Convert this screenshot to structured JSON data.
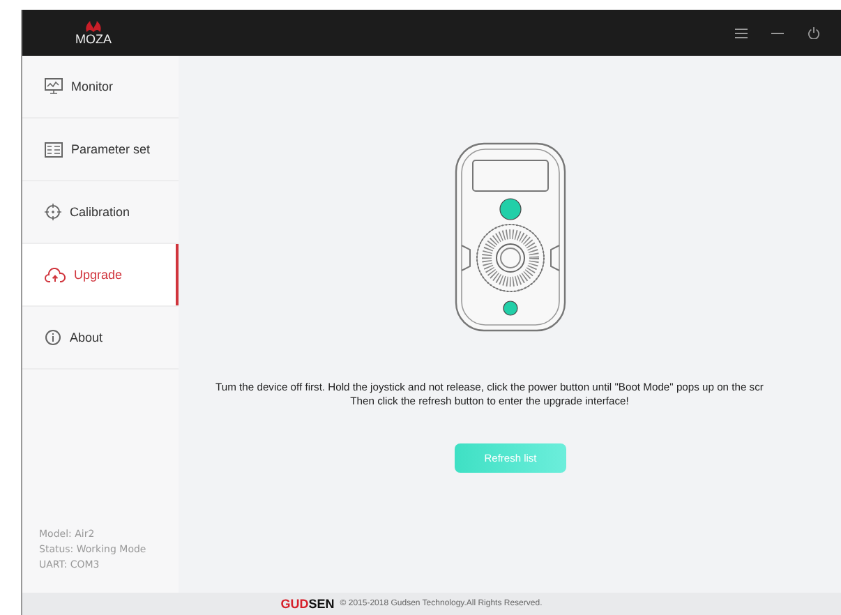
{
  "window": {
    "logo": "MOZA"
  },
  "sidebar": {
    "items": [
      {
        "label": "Monitor",
        "selected": false
      },
      {
        "label": "Parameter set",
        "selected": false
      },
      {
        "label": "Calibration",
        "selected": false
      },
      {
        "label": "Upgrade",
        "selected": true
      },
      {
        "label": "About",
        "selected": false
      }
    ],
    "status": [
      "Model: Air2",
      "Status: Working Mode",
      "UART: COM3"
    ]
  },
  "main": {
    "instructions": [
      "Tum the device off first. Hold the joystick and not release, click the power button until \"Boot Mode\" pops up on the scr",
      "Then click the refresh button to enter the upgrade interface!"
    ],
    "button": "Refresh list"
  },
  "footer": {
    "brand_accent": "GUD",
    "brand_rest": "SEN",
    "copyright": "© 2015-2018 Gudsen Technology.All Rights Reserved."
  }
}
